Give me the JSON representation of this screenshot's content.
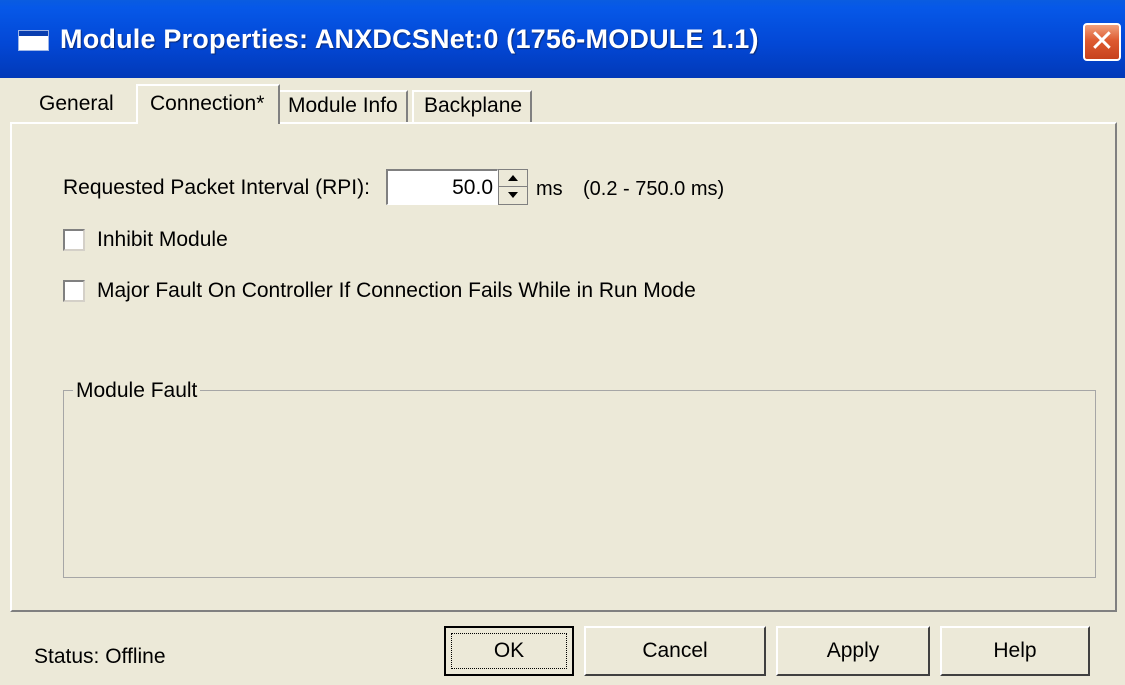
{
  "window": {
    "title": "Module Properties: ANXDCSNet:0 (1756-MODULE 1.1)",
    "close_glyph": "✕"
  },
  "tabs": [
    {
      "label": "General"
    },
    {
      "label": "Connection*"
    },
    {
      "label": "Module Info"
    },
    {
      "label": "Backplane"
    }
  ],
  "connection": {
    "rpi_label": "Requested Packet Interval (RPI):",
    "rpi_value": "50.0",
    "rpi_unit": "ms",
    "rpi_range": "(0.2 - 750.0 ms)",
    "inhibit_label": "Inhibit Module",
    "major_fault_label": "Major Fault On Controller If Connection Fails While in Run Mode",
    "module_fault_legend": "Module Fault"
  },
  "footer": {
    "status": "Status:  Offline",
    "ok": "OK",
    "cancel": "Cancel",
    "apply": "Apply",
    "help": "Help"
  },
  "colors": {
    "title_bar": "#0348d6",
    "dialog_face": "#ECE9D8",
    "close_button": "#de5b31"
  }
}
